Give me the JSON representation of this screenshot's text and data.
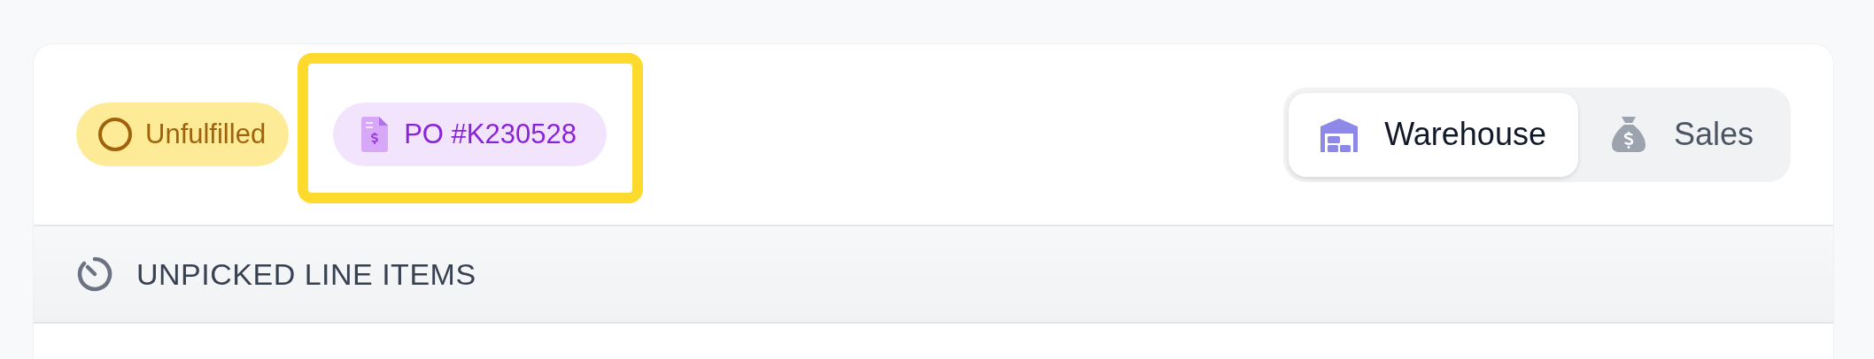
{
  "status_badge": {
    "label": "Unfulfilled"
  },
  "po_badge": {
    "label": "PO #K230528",
    "highlighted": true
  },
  "view_toggle": [
    {
      "label": "Warehouse",
      "selected": true
    },
    {
      "label": "Sales",
      "selected": false
    }
  ],
  "section": {
    "title": "UNPICKED LINE ITEMS"
  }
}
